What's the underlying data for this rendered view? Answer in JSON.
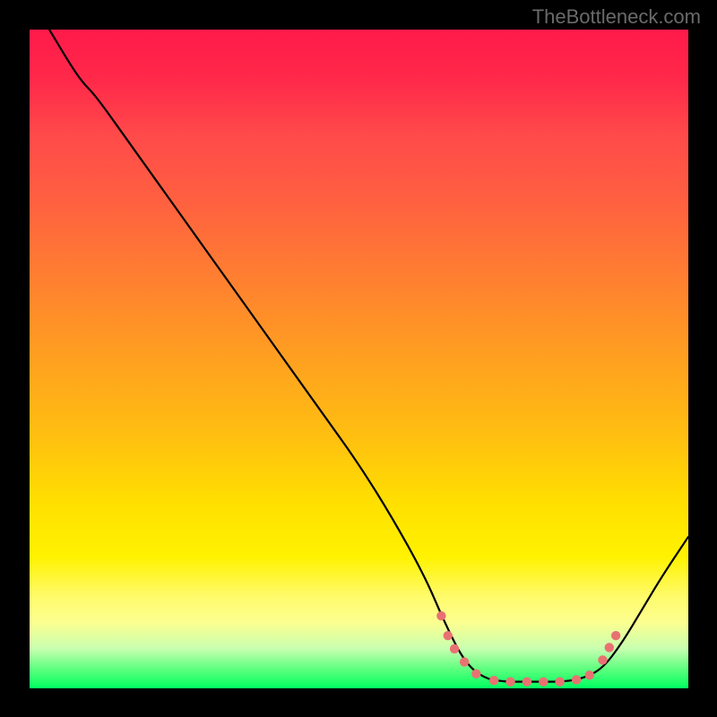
{
  "watermark": "TheBottleneck.com",
  "chart_data": {
    "type": "line",
    "title": "",
    "xlabel": "",
    "ylabel": "",
    "xlim": [
      0,
      100
    ],
    "ylim": [
      0,
      100
    ],
    "curve": {
      "name": "bottleneck-curve",
      "points": [
        {
          "x": 3,
          "y": 100
        },
        {
          "x": 6,
          "y": 95
        },
        {
          "x": 8,
          "y": 92
        },
        {
          "x": 10,
          "y": 90
        },
        {
          "x": 15,
          "y": 83
        },
        {
          "x": 20,
          "y": 76
        },
        {
          "x": 25,
          "y": 69
        },
        {
          "x": 30,
          "y": 62
        },
        {
          "x": 35,
          "y": 55
        },
        {
          "x": 40,
          "y": 48
        },
        {
          "x": 45,
          "y": 41
        },
        {
          "x": 50,
          "y": 34
        },
        {
          "x": 55,
          "y": 26
        },
        {
          "x": 60,
          "y": 17
        },
        {
          "x": 63,
          "y": 10
        },
        {
          "x": 66,
          "y": 4
        },
        {
          "x": 69,
          "y": 1.5
        },
        {
          "x": 72,
          "y": 1
        },
        {
          "x": 75,
          "y": 1
        },
        {
          "x": 78,
          "y": 1
        },
        {
          "x": 81,
          "y": 1
        },
        {
          "x": 84,
          "y": 1.5
        },
        {
          "x": 87,
          "y": 3
        },
        {
          "x": 90,
          "y": 7
        },
        {
          "x": 93,
          "y": 12
        },
        {
          "x": 96,
          "y": 17
        },
        {
          "x": 100,
          "y": 23
        }
      ]
    },
    "dotted_highlight": {
      "name": "optimal-range",
      "points": [
        {
          "x": 62.5,
          "y": 11
        },
        {
          "x": 63.5,
          "y": 8
        },
        {
          "x": 64.5,
          "y": 6
        },
        {
          "x": 66.0,
          "y": 4
        },
        {
          "x": 67.8,
          "y": 2.2
        },
        {
          "x": 70.5,
          "y": 1.2
        },
        {
          "x": 73.0,
          "y": 1.0
        },
        {
          "x": 75.5,
          "y": 1.0
        },
        {
          "x": 78.0,
          "y": 1.0
        },
        {
          "x": 80.5,
          "y": 1.0
        },
        {
          "x": 83.0,
          "y": 1.3
        },
        {
          "x": 85.0,
          "y": 2.0
        },
        {
          "x": 87.0,
          "y": 4.3
        },
        {
          "x": 88.0,
          "y": 6.2
        },
        {
          "x": 89.0,
          "y": 8.0
        }
      ],
      "color": "#e87272"
    },
    "gradient_colors": {
      "top": "#ff1a4a",
      "mid": "#ffe000",
      "bottom": "#00ff60"
    }
  }
}
